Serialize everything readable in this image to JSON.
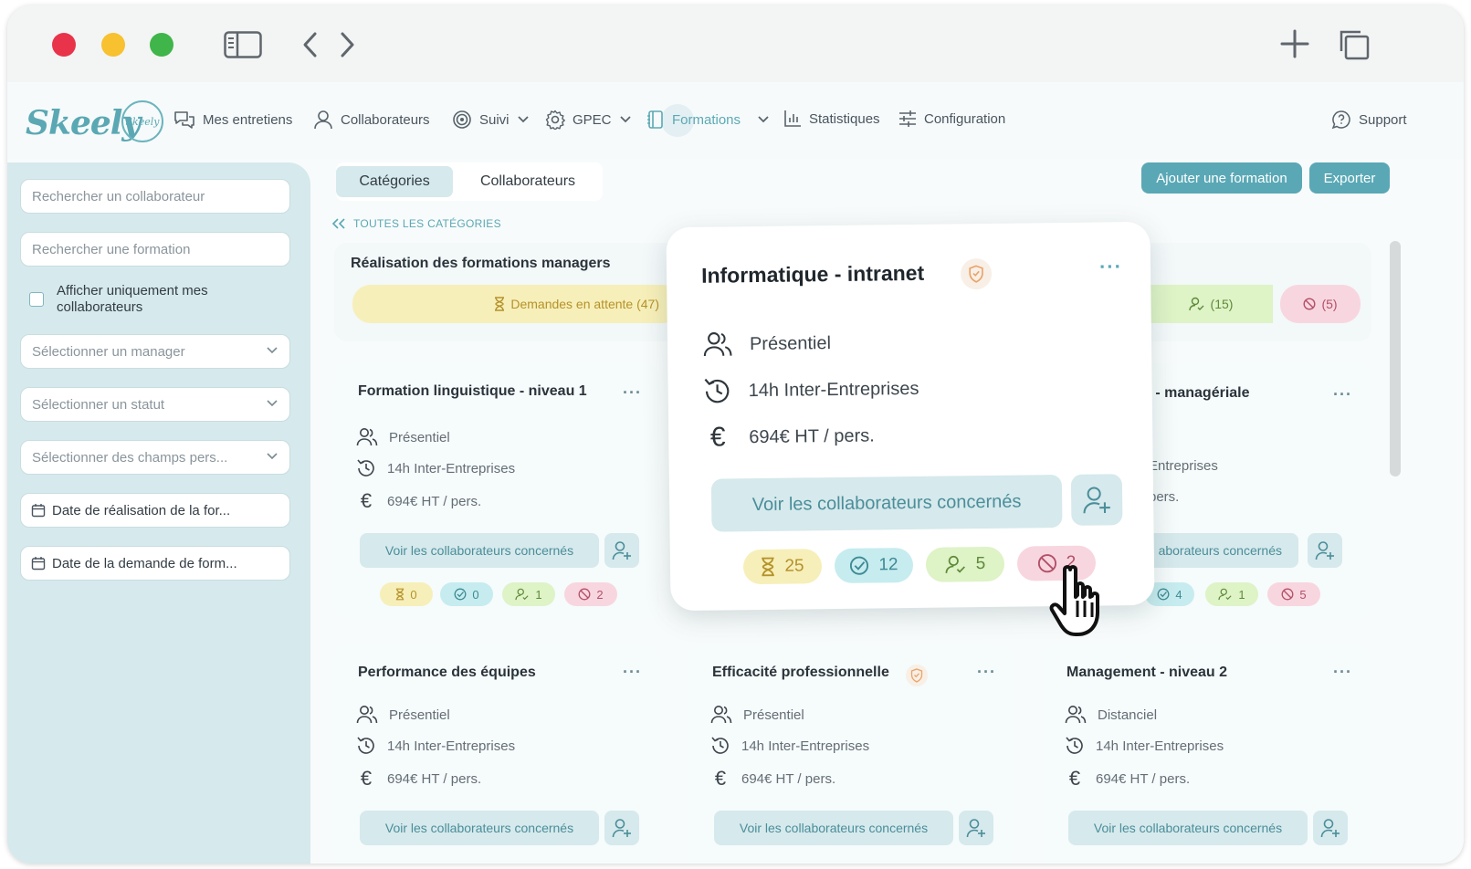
{
  "app": {
    "logo": "Skeely",
    "logo_badge": "Skeely"
  },
  "nav": {
    "interviews": "Mes entretiens",
    "employees": "Collaborateurs",
    "tracking": "Suivi",
    "gpec": "GPEC",
    "trainings": "Formations",
    "statistics": "Statistiques",
    "configuration": "Configuration",
    "support": "Support"
  },
  "sidebar": {
    "search_employee": "Rechercher un collaborateur",
    "search_training": "Rechercher une formation",
    "only_mine": "Afficher uniquement mes collaborateurs",
    "select_manager": "Sélectionner un manager",
    "select_status": "Sélectionner un statut",
    "select_fields": "Sélectionner des champs pers...",
    "date_completion": "Date de réalisation de la for...",
    "date_request": "Date de la demande de form..."
  },
  "tabs": {
    "categories": "Catégories",
    "employees": "Collaborateurs"
  },
  "actions": {
    "add_training": "Ajouter une formation",
    "export": "Exporter"
  },
  "breadcrumb": "TOUTES LES CATÉGORIES",
  "category": {
    "title": "Réalisation des formations managers",
    "pending": "Demandes en attente (47)",
    "assigned": "(15)",
    "refused": "(5)"
  },
  "common": {
    "see_employees": "Voir les collaborateurs concernés"
  },
  "cards": [
    {
      "title": "Formation linguistique - niveau 1",
      "mode": "Présentiel",
      "duration": "14h Inter-Entreprises",
      "price": "694€ HT / pers.",
      "pending": "0",
      "validated": "0",
      "assigned": "1",
      "refused": "2"
    },
    {
      "title": "e - managériale",
      "duration": "Entreprises",
      "price": "pers.",
      "button": "aborateurs concernés",
      "validated": "4",
      "assigned": "1",
      "refused": "5"
    },
    {
      "title": "Performance des équipes",
      "mode": "Présentiel",
      "duration": "14h Inter-Entreprises",
      "price": "694€ HT / pers."
    },
    {
      "title": "Efficacité professionnelle",
      "mode": "Présentiel",
      "duration": "14h Inter-Entreprises",
      "price": "694€ HT / pers."
    },
    {
      "title": "Management - niveau 2",
      "mode": "Distanciel",
      "duration": "14h Inter-Entreprises",
      "price": "694€ HT / pers."
    }
  ],
  "popup": {
    "title": "Informatique - intranet",
    "mode": "Présentiel",
    "duration": "14h Inter-Entreprises",
    "price": "694€ HT / pers.",
    "button": "Voir les collaborateurs concernés",
    "pending": "25",
    "validated": "12",
    "assigned": "5",
    "refused": "2"
  },
  "colors": {
    "accent": "#5aa8b5",
    "sidebar": "#d6e9ec"
  }
}
